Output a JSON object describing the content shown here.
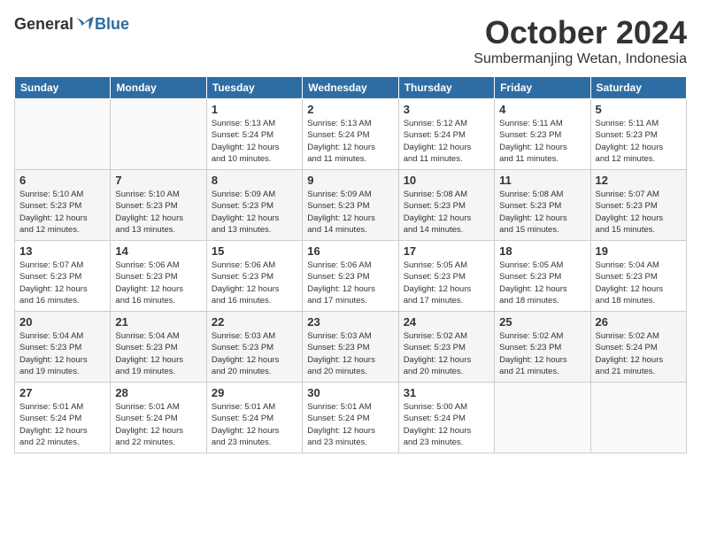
{
  "header": {
    "logo": {
      "general": "General",
      "blue": "Blue"
    },
    "title": "October 2024",
    "subtitle": "Sumbermanjing Wetan, Indonesia"
  },
  "calendar": {
    "headers": [
      "Sunday",
      "Monday",
      "Tuesday",
      "Wednesday",
      "Thursday",
      "Friday",
      "Saturday"
    ],
    "weeks": [
      [
        {
          "day": "",
          "info": ""
        },
        {
          "day": "",
          "info": ""
        },
        {
          "day": "1",
          "info": "Sunrise: 5:13 AM\nSunset: 5:24 PM\nDaylight: 12 hours\nand 10 minutes."
        },
        {
          "day": "2",
          "info": "Sunrise: 5:13 AM\nSunset: 5:24 PM\nDaylight: 12 hours\nand 11 minutes."
        },
        {
          "day": "3",
          "info": "Sunrise: 5:12 AM\nSunset: 5:24 PM\nDaylight: 12 hours\nand 11 minutes."
        },
        {
          "day": "4",
          "info": "Sunrise: 5:11 AM\nSunset: 5:23 PM\nDaylight: 12 hours\nand 11 minutes."
        },
        {
          "day": "5",
          "info": "Sunrise: 5:11 AM\nSunset: 5:23 PM\nDaylight: 12 hours\nand 12 minutes."
        }
      ],
      [
        {
          "day": "6",
          "info": "Sunrise: 5:10 AM\nSunset: 5:23 PM\nDaylight: 12 hours\nand 12 minutes."
        },
        {
          "day": "7",
          "info": "Sunrise: 5:10 AM\nSunset: 5:23 PM\nDaylight: 12 hours\nand 13 minutes."
        },
        {
          "day": "8",
          "info": "Sunrise: 5:09 AM\nSunset: 5:23 PM\nDaylight: 12 hours\nand 13 minutes."
        },
        {
          "day": "9",
          "info": "Sunrise: 5:09 AM\nSunset: 5:23 PM\nDaylight: 12 hours\nand 14 minutes."
        },
        {
          "day": "10",
          "info": "Sunrise: 5:08 AM\nSunset: 5:23 PM\nDaylight: 12 hours\nand 14 minutes."
        },
        {
          "day": "11",
          "info": "Sunrise: 5:08 AM\nSunset: 5:23 PM\nDaylight: 12 hours\nand 15 minutes."
        },
        {
          "day": "12",
          "info": "Sunrise: 5:07 AM\nSunset: 5:23 PM\nDaylight: 12 hours\nand 15 minutes."
        }
      ],
      [
        {
          "day": "13",
          "info": "Sunrise: 5:07 AM\nSunset: 5:23 PM\nDaylight: 12 hours\nand 16 minutes."
        },
        {
          "day": "14",
          "info": "Sunrise: 5:06 AM\nSunset: 5:23 PM\nDaylight: 12 hours\nand 16 minutes."
        },
        {
          "day": "15",
          "info": "Sunrise: 5:06 AM\nSunset: 5:23 PM\nDaylight: 12 hours\nand 16 minutes."
        },
        {
          "day": "16",
          "info": "Sunrise: 5:06 AM\nSunset: 5:23 PM\nDaylight: 12 hours\nand 17 minutes."
        },
        {
          "day": "17",
          "info": "Sunrise: 5:05 AM\nSunset: 5:23 PM\nDaylight: 12 hours\nand 17 minutes."
        },
        {
          "day": "18",
          "info": "Sunrise: 5:05 AM\nSunset: 5:23 PM\nDaylight: 12 hours\nand 18 minutes."
        },
        {
          "day": "19",
          "info": "Sunrise: 5:04 AM\nSunset: 5:23 PM\nDaylight: 12 hours\nand 18 minutes."
        }
      ],
      [
        {
          "day": "20",
          "info": "Sunrise: 5:04 AM\nSunset: 5:23 PM\nDaylight: 12 hours\nand 19 minutes."
        },
        {
          "day": "21",
          "info": "Sunrise: 5:04 AM\nSunset: 5:23 PM\nDaylight: 12 hours\nand 19 minutes."
        },
        {
          "day": "22",
          "info": "Sunrise: 5:03 AM\nSunset: 5:23 PM\nDaylight: 12 hours\nand 20 minutes."
        },
        {
          "day": "23",
          "info": "Sunrise: 5:03 AM\nSunset: 5:23 PM\nDaylight: 12 hours\nand 20 minutes."
        },
        {
          "day": "24",
          "info": "Sunrise: 5:02 AM\nSunset: 5:23 PM\nDaylight: 12 hours\nand 20 minutes."
        },
        {
          "day": "25",
          "info": "Sunrise: 5:02 AM\nSunset: 5:23 PM\nDaylight: 12 hours\nand 21 minutes."
        },
        {
          "day": "26",
          "info": "Sunrise: 5:02 AM\nSunset: 5:24 PM\nDaylight: 12 hours\nand 21 minutes."
        }
      ],
      [
        {
          "day": "27",
          "info": "Sunrise: 5:01 AM\nSunset: 5:24 PM\nDaylight: 12 hours\nand 22 minutes."
        },
        {
          "day": "28",
          "info": "Sunrise: 5:01 AM\nSunset: 5:24 PM\nDaylight: 12 hours\nand 22 minutes."
        },
        {
          "day": "29",
          "info": "Sunrise: 5:01 AM\nSunset: 5:24 PM\nDaylight: 12 hours\nand 23 minutes."
        },
        {
          "day": "30",
          "info": "Sunrise: 5:01 AM\nSunset: 5:24 PM\nDaylight: 12 hours\nand 23 minutes."
        },
        {
          "day": "31",
          "info": "Sunrise: 5:00 AM\nSunset: 5:24 PM\nDaylight: 12 hours\nand 23 minutes."
        },
        {
          "day": "",
          "info": ""
        },
        {
          "day": "",
          "info": ""
        }
      ]
    ]
  }
}
